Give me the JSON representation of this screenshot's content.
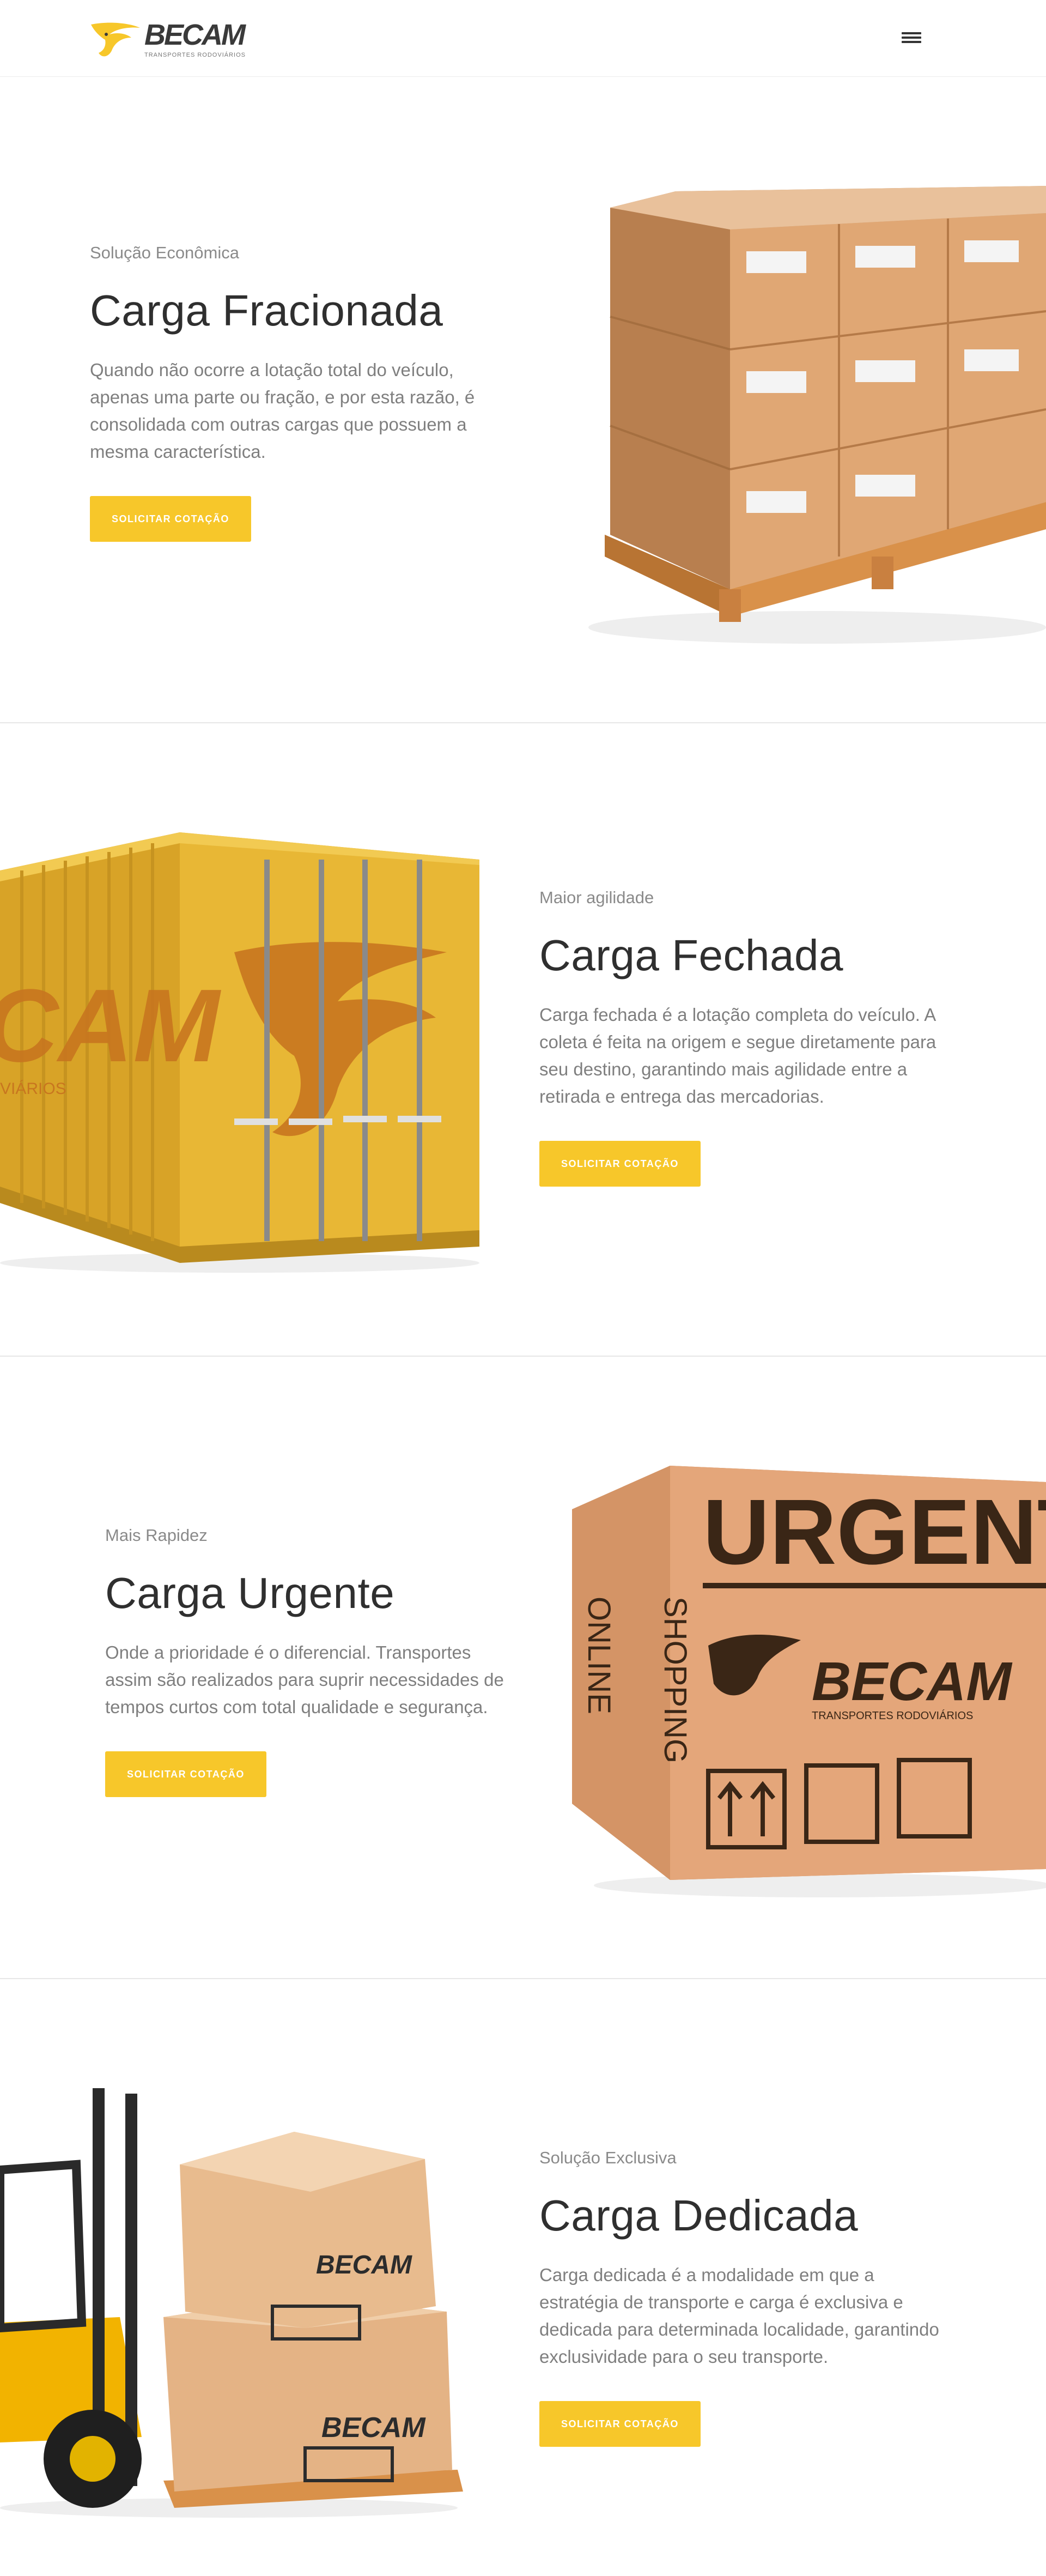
{
  "header": {
    "logo_text": "BECAM",
    "logo_subtitle": "TRANSPORTES RODOVIÁRIOS",
    "menu_icon": "hamburger-menu-icon"
  },
  "colors": {
    "accent": "#F7C72A",
    "text_dark": "#2F2F2F",
    "text_muted": "#7F7F7F"
  },
  "sections": [
    {
      "eyebrow": "Solução Econômica",
      "title": "Carga Fracionada",
      "description": "Quando não ocorre a lotação total do veículo, apenas uma parte ou fração, e por esta razão, é consolidada com outras cargas que possuem a mesma característica.",
      "cta": "SOLICITAR COTAÇÃO",
      "image": "pallet-boxes-image"
    },
    {
      "eyebrow": "Maior agilidade",
      "title": "Carga Fechada",
      "description": "Carga fechada é a lotação completa do veículo. A coleta é feita na origem e segue diretamente para seu destino, garantindo mais agilidade entre a retirada e entrega das mercadorias.",
      "cta": "SOLICITAR COTAÇÃO",
      "image": "shipping-container-image",
      "image_text": "CAM",
      "image_subtext": "VIÁRIOS"
    },
    {
      "eyebrow": "Mais Rapidez",
      "title": "Carga Urgente",
      "description": "Onde a prioridade é o diferencial. Transportes assim são realizados para suprir necessidades de tempos curtos com total qualidade e segurança.",
      "cta": "SOLICITAR COTAÇÃO",
      "image": "urgent-box-image",
      "image_text": "URGENT",
      "image_side_text_1": "ONLINE",
      "image_side_text_2": "SHOPPING",
      "image_brand": "BECAM",
      "image_brand_sub": "TRANSPORTES RODOVIÁRIOS"
    },
    {
      "eyebrow": "Solução Exclusiva",
      "title": "Carga Dedicada",
      "description": "Carga dedicada é a modalidade em que a estratégia de transporte e carga é exclusiva e dedicada para determinada localidade, garantindo exclusividade para o seu transporte.",
      "cta": "SOLICITAR COTAÇÃO",
      "image": "forklift-boxes-image",
      "image_brand": "BECAM"
    }
  ]
}
